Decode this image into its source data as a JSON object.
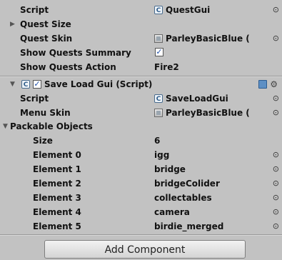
{
  "quest_gui": {
    "script_label": "Script",
    "script_value": "QuestGui",
    "quest_size_label": "Quest Size",
    "quest_skin_label": "Quest Skin",
    "quest_skin_value": "ParleyBasicBlue (",
    "show_summary_label": "Show Quests Summary",
    "show_summary_checked": "✓",
    "show_action_label": "Show Quests Action",
    "show_action_value": "Fire2"
  },
  "save_load": {
    "component_title": "Save Load Gui (Script)",
    "enabled_check": "✓",
    "script_label": "Script",
    "script_value": "SaveLoadGui",
    "menu_skin_label": "Menu Skin",
    "menu_skin_value": "ParleyBasicBlue (",
    "packable_label": "Packable Objects",
    "size_label": "Size",
    "size_value": "6",
    "elements": [
      {
        "label": "Element 0",
        "value": "igg"
      },
      {
        "label": "Element 1",
        "value": "bridge"
      },
      {
        "label": "Element 2",
        "value": "bridgeColider"
      },
      {
        "label": "Element 3",
        "value": "collectables"
      },
      {
        "label": "Element 4",
        "value": "camera"
      },
      {
        "label": "Element 5",
        "value": "birdie_merged"
      }
    ]
  },
  "add_component_label": "Add Component",
  "icons": {
    "picker": "⊙",
    "fold_closed": "▶",
    "fold_open": "▼",
    "script_icon_letter": "C"
  }
}
